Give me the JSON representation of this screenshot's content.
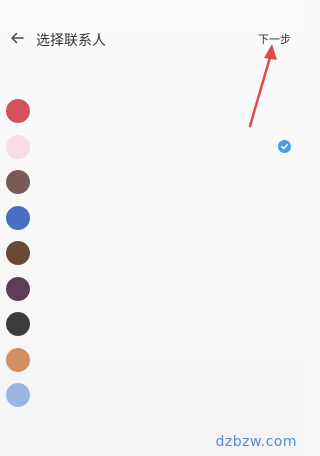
{
  "header": {
    "title": "选择联系人",
    "next_label": "下一步"
  },
  "icons": {
    "back": "arrow-left-icon",
    "selected": "check-circle-icon",
    "annotation": "red-arrow-annotation"
  },
  "colors": {
    "accent": "#4a9be9",
    "annotation": "#e04a4a",
    "watermark": "#4f8fd6"
  },
  "contacts": [
    {
      "name": "",
      "avatar_color": "#d4525b",
      "selected": false
    },
    {
      "name": "",
      "avatar_color": "#f6dde3",
      "selected": true
    },
    {
      "name": "",
      "avatar_color": "#7b5a56",
      "selected": false
    },
    {
      "name": "",
      "avatar_color": "#4a6fc2",
      "selected": false
    },
    {
      "name": "",
      "avatar_color": "#6a4a36",
      "selected": false
    },
    {
      "name": "",
      "avatar_color": "#5d3f55",
      "selected": false
    },
    {
      "name": "",
      "avatar_color": "#3c3c3c",
      "selected": false
    },
    {
      "name": "",
      "avatar_color": "#d28f62",
      "selected": false
    },
    {
      "name": "",
      "avatar_color": "#9ab7e0",
      "selected": false
    }
  ],
  "watermark": "dzbzw.com"
}
